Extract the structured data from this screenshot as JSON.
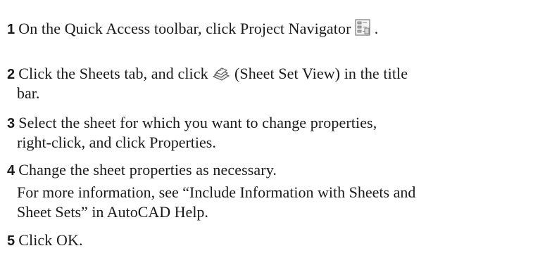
{
  "steps": [
    {
      "number": "1",
      "text_before": "On the Quick Access toolbar, click Project Navigator",
      "icon": "project-navigator-icon",
      "text_after": "."
    },
    {
      "number": "2",
      "text_before": "Click the Sheets tab, and click",
      "icon": "sheet-set-view-icon",
      "text_after": "(Sheet Set View) in the title",
      "line2": "bar."
    },
    {
      "number": "3",
      "line1": "Select the sheet for which you want to change properties,",
      "line2": "right-click, and click Properties."
    },
    {
      "number": "4",
      "line1": "Change the sheet properties as necessary.",
      "note_line1": "For more information, see “Include Information with Sheets and",
      "note_line2": "Sheet Sets” in AutoCAD Help."
    },
    {
      "number": "5",
      "line1": "Click OK."
    }
  ]
}
